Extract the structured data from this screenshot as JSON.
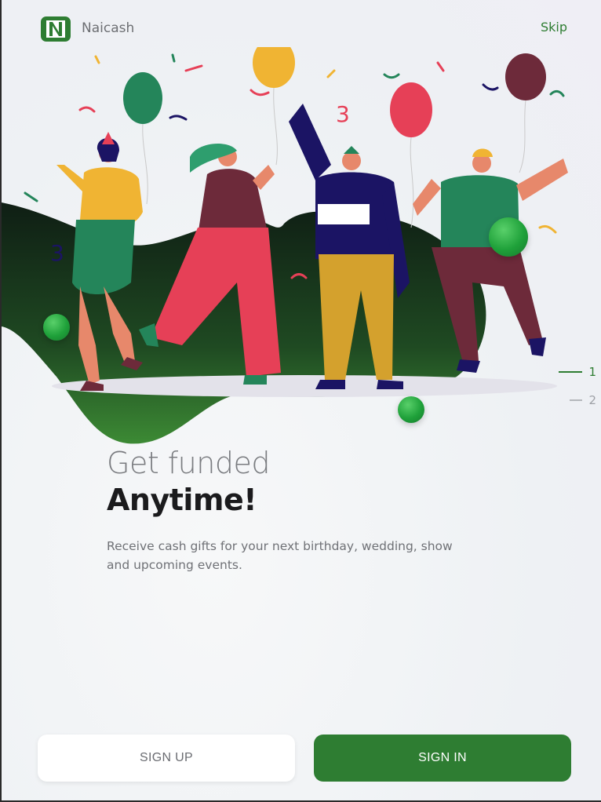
{
  "app": {
    "logo_letter": "N",
    "name": "Naicash",
    "brand_color": "#2e7d32"
  },
  "header": {
    "skip_label": "Skip"
  },
  "pager": {
    "items": [
      {
        "label": "1",
        "active": true
      },
      {
        "label": "2",
        "active": false
      }
    ]
  },
  "content": {
    "headline_light": "Get funded",
    "headline_bold": "Anytime!",
    "description": "Receive cash gifts for your next birthday, wedding, show and upcoming events."
  },
  "actions": {
    "signup_label": "SIGN UP",
    "signin_label": "SIGN IN"
  },
  "illustration": {
    "subject": "party-people-icon"
  }
}
